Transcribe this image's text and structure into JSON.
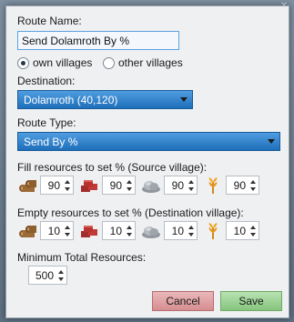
{
  "background": {
    "close_glyph": "✕"
  },
  "dialog": {
    "route_name_label": "Route Name:",
    "route_name_value": "Send Dolamroth By %",
    "radio_own_label": "own villages",
    "radio_other_label": "other villages",
    "radio_selected": "own villages",
    "destination_label": "Destination:",
    "destination_value": "Dolamroth (40,120)",
    "route_type_label": "Route Type:",
    "route_type_value": "Send By %",
    "fill_label": "Fill resources to set % (Source village):",
    "fill_values": [
      "90",
      "90",
      "90",
      "90"
    ],
    "empty_label": "Empty resources to set % (Destination village):",
    "empty_values": [
      "10",
      "10",
      "10",
      "10"
    ],
    "min_total_label": "Minimum Total Resources:",
    "min_total_value": "500",
    "cancel_label": "Cancel",
    "save_label": "Save"
  },
  "resource_icons": [
    "wood-icon",
    "clay-icon",
    "iron-icon",
    "crop-icon"
  ],
  "colors": {
    "accent": "#2a7fcf",
    "cancel": "#dba0a3",
    "save": "#9cd494"
  }
}
